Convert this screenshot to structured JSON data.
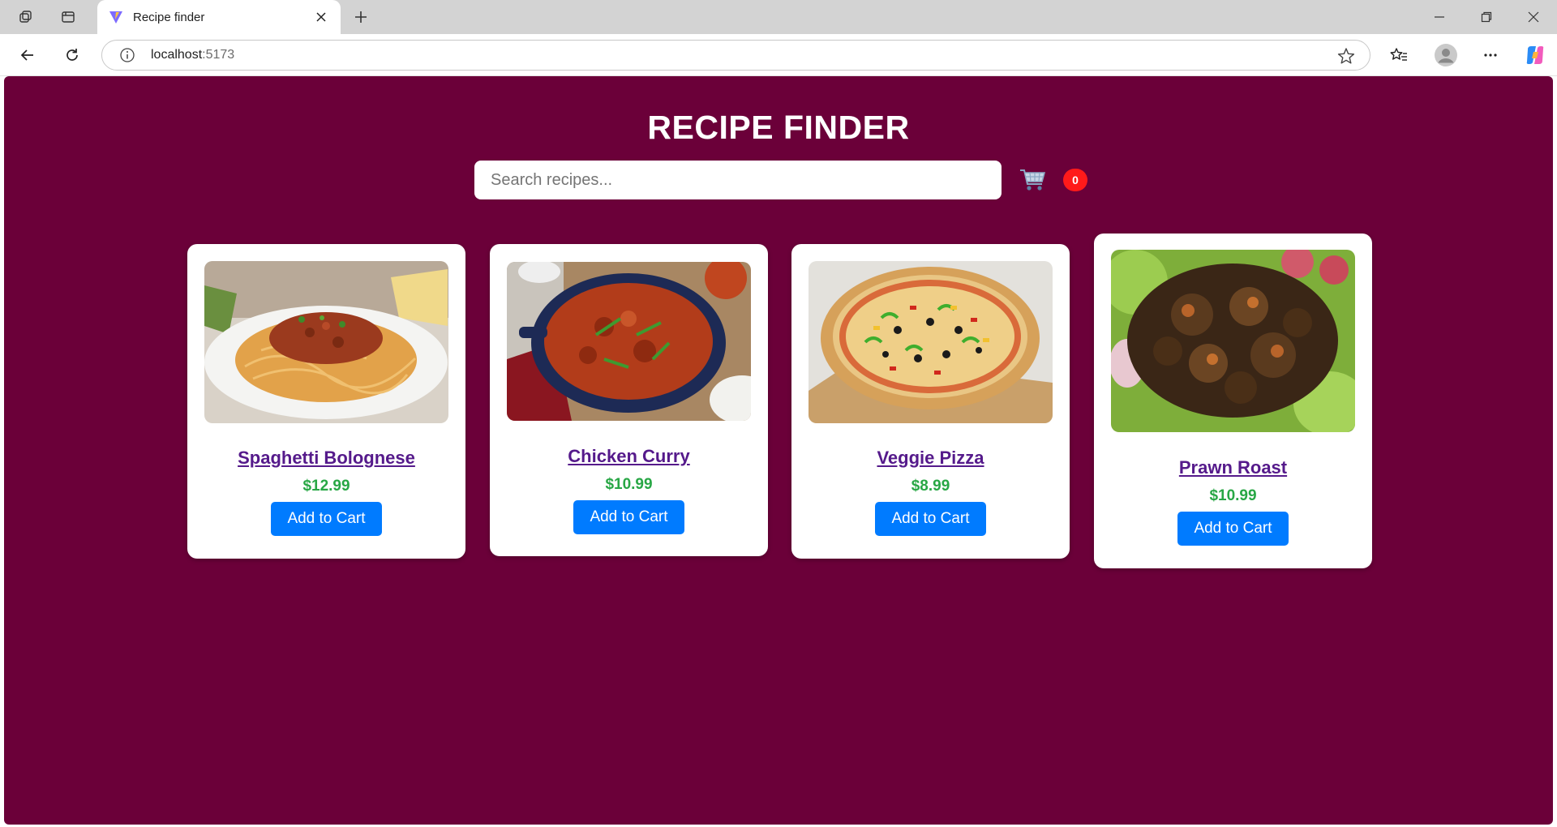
{
  "browser": {
    "tab_title": "Recipe finder",
    "url_host": "localhost",
    "url_port": ":5173"
  },
  "app": {
    "title": "RECIPE FINDER",
    "search_placeholder": "Search recipes...",
    "cart_count": "0",
    "background_color": "#6b0039"
  },
  "recipes": [
    {
      "name": "Spaghetti Bolognese",
      "price": "$12.99",
      "button": "Add to Cart"
    },
    {
      "name": "Chicken Curry",
      "price": "$10.99",
      "button": "Add to Cart"
    },
    {
      "name": "Veggie Pizza",
      "price": "$8.99",
      "button": "Add to Cart"
    },
    {
      "name": "Prawn Roast",
      "price": "$10.99",
      "button": "Add to Cart"
    }
  ],
  "colors": {
    "price": "#28a745",
    "button": "#007bff",
    "badge": "#ff1a1a",
    "link": "#551a8b"
  }
}
